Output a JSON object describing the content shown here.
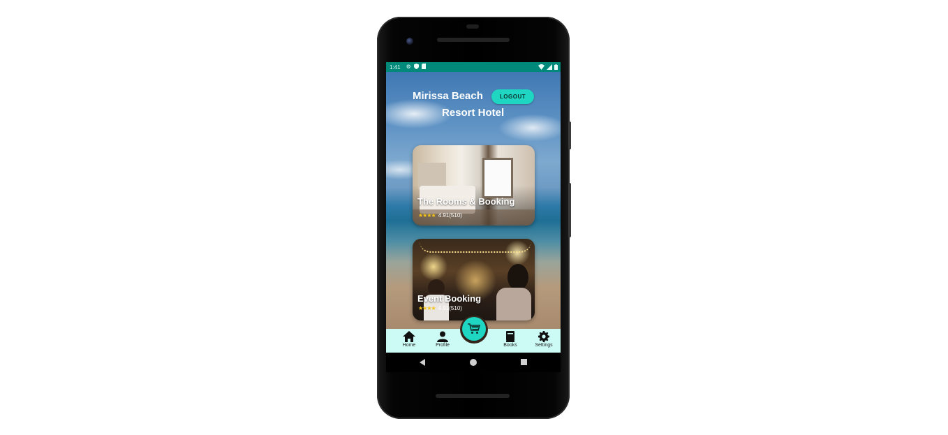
{
  "status_bar": {
    "time": "1:41",
    "icons": [
      "settings-icon",
      "shield-icon",
      "sd-card-icon",
      "wifi-icon",
      "signal-icon",
      "battery-icon"
    ],
    "background_color": "#00897b"
  },
  "header": {
    "title_line1": "Mirissa Beach",
    "title_line2": "Resort Hotel",
    "logout_label": "LOGOUT",
    "accent_color": "#1ed6c2"
  },
  "cards": [
    {
      "title": "The Rooms & Booking",
      "stars": "★★★★",
      "rating": "4.91(510)"
    },
    {
      "title": "Event Booking",
      "stars": "★★★★",
      "rating": "4.91(510)"
    }
  ],
  "bottom_nav": {
    "items": [
      {
        "label": "Home",
        "icon": "home-icon"
      },
      {
        "label": "Profile",
        "icon": "person-icon"
      },
      {
        "label": "Books",
        "icon": "book-icon"
      },
      {
        "label": "Settings",
        "icon": "gear-icon"
      }
    ],
    "fab_icon": "cart-icon",
    "background_color": "#ccfbf6"
  },
  "system_nav": {
    "icons": [
      "back-icon",
      "home-circle-icon",
      "recents-icon"
    ]
  }
}
